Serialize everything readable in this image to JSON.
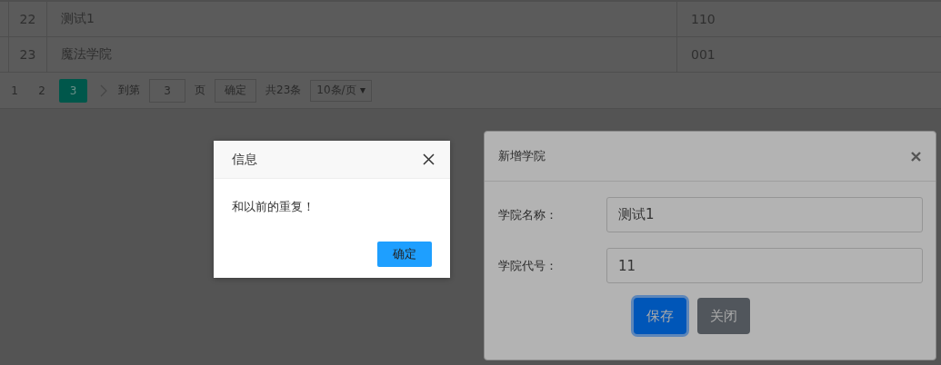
{
  "table": {
    "rows": [
      {
        "index": "22",
        "name": "测试1",
        "code": "110"
      },
      {
        "index": "23",
        "name": "魔法学院",
        "code": "001"
      }
    ]
  },
  "pagination": {
    "pages": [
      {
        "label": "1",
        "selected": false
      },
      {
        "label": "2",
        "selected": false
      },
      {
        "label": "3",
        "selected": true
      }
    ],
    "goto_label": "到第",
    "page_input": "3",
    "page_suffix": "页",
    "confirm": "确定",
    "total": "共23条",
    "page_size": "10条/页"
  },
  "alert": {
    "title": "信息",
    "message": "和以前的重复！",
    "ok": "确定"
  },
  "form_modal": {
    "title": "新增学院",
    "fields": [
      {
        "label": "学院名称：",
        "value": "测试1"
      },
      {
        "label": "学院代号：",
        "value": "11"
      }
    ],
    "buttons": [
      {
        "label": "保存",
        "kind": "primary"
      },
      {
        "label": "关闭",
        "kind": "secondary"
      }
    ]
  }
}
